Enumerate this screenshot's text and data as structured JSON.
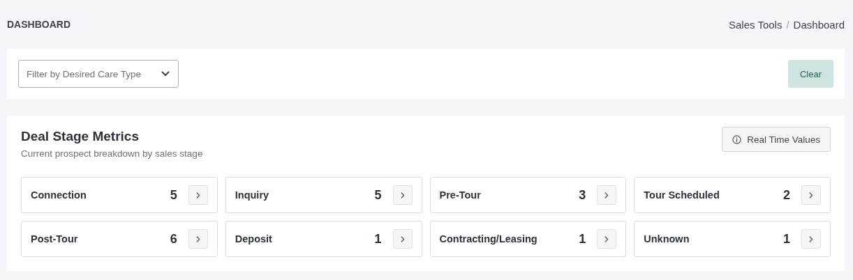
{
  "page_title": "DASHBOARD",
  "breadcrumb": [
    "Sales Tools",
    "Dashboard"
  ],
  "breadcrumb_separator": "/",
  "filter": {
    "placeholder": "Filter by Desired Care Type",
    "clear_button": "Clear"
  },
  "metrics": {
    "title": "Deal Stage Metrics",
    "subtitle": "Current prospect breakdown by sales stage",
    "real_time_button": "Real Time Values",
    "stages": [
      {
        "name": "Connection",
        "count": "5"
      },
      {
        "name": "Inquiry",
        "count": "5"
      },
      {
        "name": "Pre-Tour",
        "count": "3"
      },
      {
        "name": "Tour Scheduled",
        "count": "2"
      },
      {
        "name": "Post-Tour",
        "count": "6"
      },
      {
        "name": "Deposit",
        "count": "1"
      },
      {
        "name": "Contracting/Leasing",
        "count": "1"
      },
      {
        "name": "Unknown",
        "count": "1"
      }
    ]
  }
}
